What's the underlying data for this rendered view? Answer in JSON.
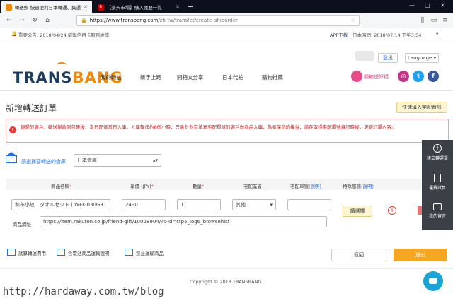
{
  "browser": {
    "tabs": [
      "轉送郵-快速便利日本轉運、集運",
      "【楽天市場】購入履歴一覧"
    ],
    "url_domain": "https://www.transbang.com",
    "url_path": "/zh-tw/transfet/create_shiporder",
    "url_placeholder": "搜尋",
    "window_controls": [
      "—",
      "□",
      "✕"
    ]
  },
  "topinfo": {
    "announcement": "重要公告: 2018/04/24 威聯信用卡服務維護",
    "app_download": "APP下載",
    "japan_time": "日本時間: 2018/07/14 下午3:54",
    "menu_caret": "▾"
  },
  "header": {
    "logo_part1": "TRANS",
    "logo_part2": "BANG",
    "logout": "登出",
    "language": "Language",
    "nav": [
      "我的轉送",
      "新手上路",
      "開箱文分享",
      "日本代拍",
      "購物推薦"
    ],
    "promo": "開箱送好禮",
    "colors": {
      "brand_blue": "#1d3a5f",
      "brand_orange": "#f08a00",
      "accent_orange": "#f5a623",
      "warning_red": "#e53935"
    }
  },
  "form": {
    "title": "新增轉送訂單",
    "quick_fill_button": "快速填入宅配資訊",
    "notice_text": "親愛的客戶，轉送幫收到包裹後，當日配達當日入庫，入庫操作約8個小時，只會針對有填寫宅配單號的客戶做商品入庫，為確保您的權益，請在取得宅配單號資訊時候，更新訂單內容。",
    "warehouse_label": "請選擇要轉送的倉庫",
    "warehouse_value": "日本倉庫",
    "columns": {
      "product_name": "商品名稱",
      "price": "單價 (JPY)",
      "quantity": "數量",
      "carrier": "宅配業者",
      "tracking": "宅配單號",
      "tracking_help": "(說明)",
      "special": "特殊服務",
      "special_help": "(說明)"
    },
    "required_mark": "*",
    "row": {
      "product_name": "和布小紋　タオルセット ( WFK-030GR",
      "price": "2490",
      "quantity": "1",
      "carrier": "其他",
      "tracking": "",
      "special_button": "請選擇",
      "url_label": "商品網址",
      "url": "https://item.rakuten.co.jp/friend-gift/10028904/?s-id=stp5_log6_browsehist"
    },
    "links": [
      "試算轉運費用",
      "含電池商品運輸說明",
      "禁止運輸商品"
    ],
    "back_button": "返回",
    "submit_button": "送出"
  },
  "sidepanel": {
    "items": [
      "建立轉運單",
      "運費試算",
      "我的留言"
    ]
  },
  "footer": {
    "copyright": "Copyright © 2018 TRANSBANG"
  },
  "watermark": "http://hardaway.com.tw/blog"
}
